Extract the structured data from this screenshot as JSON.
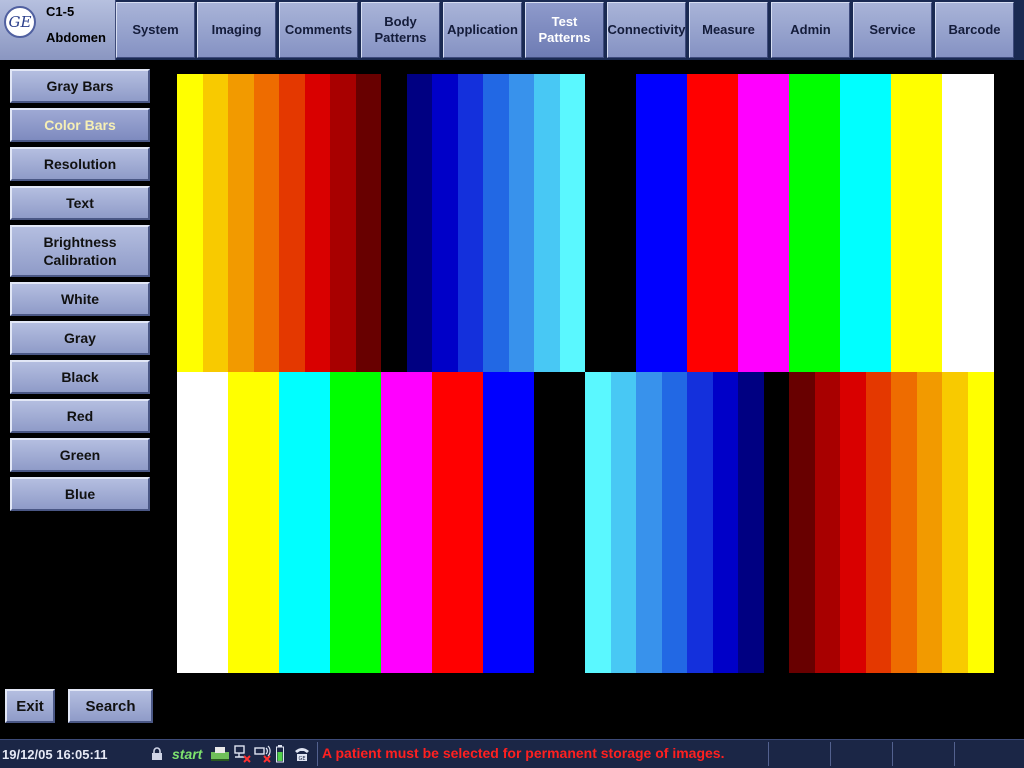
{
  "header": {
    "logo_text": "GE",
    "probe": "C1-5",
    "preset": "Abdomen",
    "tabs": [
      {
        "label": "System"
      },
      {
        "label": "Imaging"
      },
      {
        "label": "Comments"
      },
      {
        "label": "Body Patterns"
      },
      {
        "label": "Application"
      },
      {
        "label": "Test Patterns",
        "active": true
      },
      {
        "label": "Connectivity"
      },
      {
        "label": "Measure"
      },
      {
        "label": "Admin"
      },
      {
        "label": "Service"
      },
      {
        "label": "Barcode"
      }
    ]
  },
  "sidebar": {
    "items": [
      {
        "label": "Gray Bars"
      },
      {
        "label": "Color Bars",
        "active": true
      },
      {
        "label": "Resolution"
      },
      {
        "label": "Text"
      },
      {
        "label": "Brightness Calibration"
      },
      {
        "label": "White"
      },
      {
        "label": "Gray"
      },
      {
        "label": "Black"
      },
      {
        "label": "Red"
      },
      {
        "label": "Green"
      },
      {
        "label": "Blue"
      }
    ]
  },
  "footer_buttons": {
    "exit": "Exit",
    "search": "Search"
  },
  "pattern": {
    "top_left": [
      "#ffff00",
      "#f8ca00",
      "#f29a00",
      "#ee6c00",
      "#e43800",
      "#d90000",
      "#a80000",
      "#680000",
      "#000000",
      "#000082",
      "#0000c8",
      "#1430dc",
      "#2268e4",
      "#3892ec",
      "#48c8f4",
      "#5af8ff"
    ],
    "top_right": [
      "#000000",
      "#000000",
      "#0000ff",
      "#0000ff",
      "#ff0000",
      "#ff0000",
      "#ff00ff",
      "#ff00ff",
      "#00ff00",
      "#00ff00",
      "#00ffff",
      "#00ffff",
      "#ffff00",
      "#ffff00",
      "#ffffff",
      "#ffffff"
    ],
    "bottom_left": [
      "#ffffff",
      "#ffffff",
      "#ffff00",
      "#ffff00",
      "#00ffff",
      "#00ffff",
      "#00ff00",
      "#00ff00",
      "#ff00ff",
      "#ff00ff",
      "#ff0000",
      "#ff0000",
      "#0000ff",
      "#0000ff",
      "#000000",
      "#000000"
    ],
    "bottom_right": [
      "#5af8ff",
      "#48c8f4",
      "#3892ec",
      "#2268e4",
      "#1430dc",
      "#0000c8",
      "#000082",
      "#000000",
      "#680000",
      "#a80000",
      "#d90000",
      "#e43800",
      "#ee6c00",
      "#f29a00",
      "#f8ca00",
      "#ffff00"
    ]
  },
  "status": {
    "datetime": "19/12/05 16:05:11",
    "start_label": "start",
    "message": "A patient must be selected for permanent storage of images.",
    "icons": [
      "lock-icon",
      "printer-icon",
      "network-error-icon",
      "wireless-error-icon",
      "battery-icon",
      "phone-icon"
    ]
  }
}
